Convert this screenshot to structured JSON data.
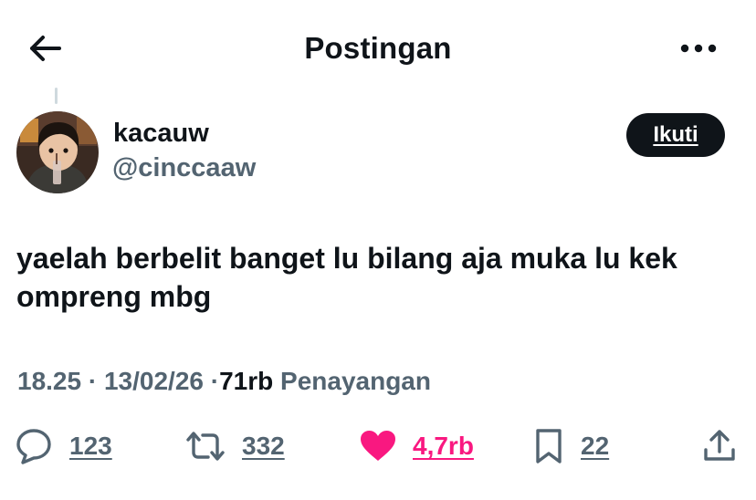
{
  "header": {
    "title": "Postingan",
    "back_icon": "arrow-left-icon",
    "more_icon": "more-horizontal-icon"
  },
  "author": {
    "display_name": "kacauw",
    "handle": "@cinccaaw",
    "follow_label": "Ikuti"
  },
  "tweet": {
    "text": "yaelah berbelit banget lu bilang aja muka lu kek ompreng mbg"
  },
  "meta": {
    "time": "18.25",
    "separator": "·",
    "date": "13/02/26",
    "views_count": "71rb",
    "views_label": "Penayangan"
  },
  "actions": {
    "replies": "123",
    "reposts": "332",
    "likes": "4,7rb",
    "bookmarks": "22"
  },
  "colors": {
    "text_primary": "#0f1419",
    "text_secondary": "#536471",
    "like_pink": "#f91880",
    "button_dark": "#0f1419",
    "thread_line": "#cfd9de"
  }
}
